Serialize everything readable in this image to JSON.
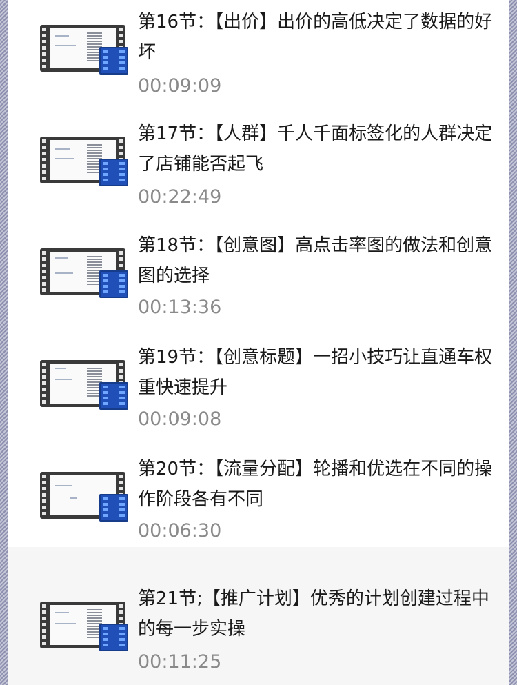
{
  "lessons": [
    {
      "title": "第16节：【出价】出价的高低决定了数据的好坏",
      "duration": "00:09:09",
      "icon": "video-file-icon"
    },
    {
      "title": "第17节：【人群】千人千面标签化的人群决定了店铺能否起飞",
      "duration": "00:22:49",
      "icon": "video-file-icon"
    },
    {
      "title": "第18节：【创意图】高点击率图的做法和创意图的选择",
      "duration": "00:13:36",
      "icon": "video-file-icon"
    },
    {
      "title": "第19节：【创意标题】一招小技巧让直通车权重快速提升",
      "duration": "00:09:08",
      "icon": "video-file-icon"
    },
    {
      "title": "第20节：【流量分配】轮播和优选在不同的操作阶段各有不同",
      "duration": "00:06:30",
      "icon": "video-file-icon"
    },
    {
      "title": "第21节;【推广计划】优秀的计划创建过程中的每一步实操",
      "duration": "00:11:25",
      "icon": "video-file-icon"
    }
  ]
}
